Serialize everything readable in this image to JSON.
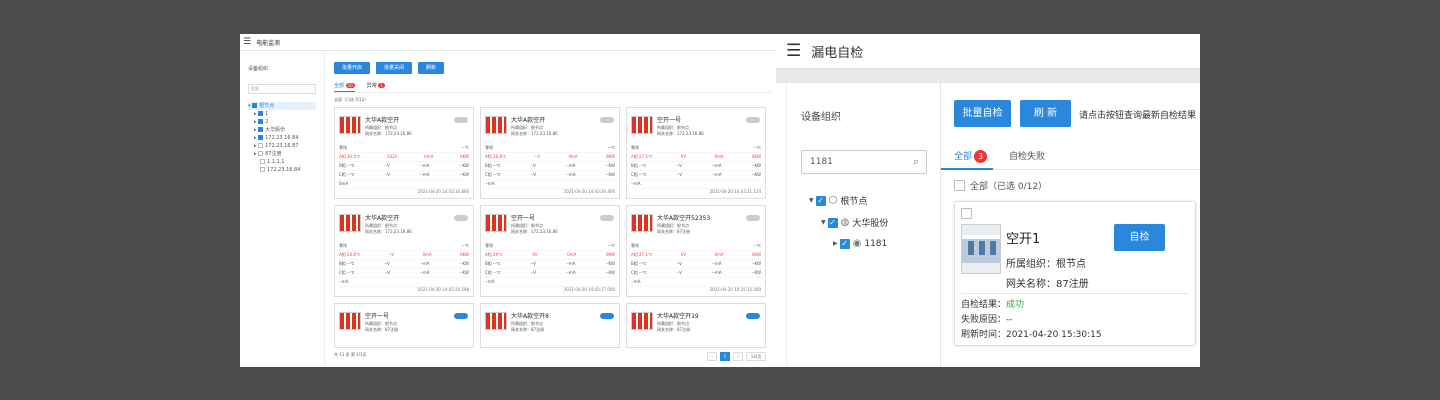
{
  "left": {
    "title": "电能监测",
    "tree_title": "设备组织",
    "search_placeholder": "搜索",
    "tree_nodes": [
      "根节点",
      "1",
      "2",
      "大华股份",
      "172.23.16.84",
      "172.23.16.87",
      "87注册",
      "1.1.1.1",
      "172.23.16.84"
    ],
    "buttons": [
      "批量开启",
      "批量关闭",
      "刷新"
    ],
    "tabs": [
      {
        "label": "全部",
        "badge": "10"
      },
      {
        "label": "异常",
        "badge": "1"
      }
    ],
    "select_all": "全部（已选 0/12）",
    "cards": [
      {
        "name": "大华A款空开",
        "org": "所属组织：根节点",
        "gw": "网关名称：172.23.16.86",
        "on": false,
        "rows": [
          [
            "零线",
            "--℃"
          ],
          [
            "A相 30.0℃",
            "232V",
            "0mA",
            "0KW"
          ],
          [
            "B相 --℃",
            "--V",
            "--mA",
            "--KW"
          ],
          [
            "C相 --℃",
            "--V",
            "--mA",
            "--KW"
          ],
          [
            "0mA",
            ""
          ]
        ],
        "time": "2021-04-20 14:43:16.866"
      },
      {
        "name": "大华A款空开",
        "org": "所属组织：根节点",
        "gw": "网关名称：172.23.16.86",
        "on": false,
        "rows": [
          [
            "零线",
            "--℃"
          ],
          [
            "A相 28.8℃",
            "--V",
            "0mA",
            "0KW"
          ],
          [
            "B相 --℃",
            "--V",
            "--mA",
            "--KW"
          ],
          [
            "C相 --℃",
            "--V",
            "--mA",
            "--KW"
          ],
          [
            "--mA",
            ""
          ]
        ],
        "time": "2021-04-20 14:43:20.406"
      },
      {
        "name": "空开一号",
        "org": "所属组织：根节点",
        "gw": "网关名称：172.23.16.86",
        "on": false,
        "rows": [
          [
            "零线",
            "--℃"
          ],
          [
            "A相 27.5℃",
            "0V",
            "0mA",
            "0KW"
          ],
          [
            "B相 --℃",
            "--V",
            "--mA",
            "--KW"
          ],
          [
            "C相 --℃",
            "--V",
            "--mA",
            "--KW"
          ],
          [
            "--mA",
            ""
          ]
        ],
        "time": "2021-04-20 14:43:21.124"
      },
      {
        "name": "大华A款空开",
        "org": "所属组织：根节点",
        "gw": "网关名称：172.23.16.86",
        "on": false,
        "rows": [
          [
            "零线",
            "--℃"
          ],
          [
            "A相 24.8℃",
            "--V",
            "0mA",
            "0KW"
          ],
          [
            "B相 --℃",
            "--V",
            "--mA",
            "--KW"
          ],
          [
            "C相 --℃",
            "--V",
            "--mA",
            "--KW"
          ],
          [
            "--mA",
            ""
          ]
        ],
        "time": "2021-04-20 14:43:20.598"
      },
      {
        "name": "空开一号",
        "org": "所属组织：根节点",
        "gw": "网关名称：172.23.16.86",
        "on": false,
        "rows": [
          [
            "零线",
            "--℃"
          ],
          [
            "A相 29℃",
            "0V",
            "0mA",
            "0KW"
          ],
          [
            "B相 --℃",
            "--V",
            "--mA",
            "--KW"
          ],
          [
            "C相 --℃",
            "--V",
            "--mA",
            "--KW"
          ],
          [
            "--mA",
            ""
          ]
        ],
        "time": "2021-04-20 14:43:17.000"
      },
      {
        "name": "大华A款空开52353",
        "org": "所属组织：根节点",
        "gw": "网关名称：87注册",
        "on": false,
        "rows": [
          [
            "零线",
            "--℃"
          ],
          [
            "A相 27.1℃",
            "0V",
            "0mA",
            "0KW"
          ],
          [
            "B相 --℃",
            "--V",
            "--mA",
            "--KW"
          ],
          [
            "C相 --℃",
            "--V",
            "--mA",
            "--KW"
          ],
          [
            "--mA",
            ""
          ]
        ],
        "time": "2021-04-20 10:25:15.000"
      },
      {
        "name": "空开一号",
        "org": "所属组织：根节点",
        "gw": "网关名称：87注册",
        "on": true
      },
      {
        "name": "大华A款空开8",
        "org": "所属组织：根节点",
        "gw": "网关名称：87注册",
        "on": true
      },
      {
        "name": "大华A款空开19",
        "org": "所属组织：根节点",
        "gw": "网关名称：87注册",
        "on": true
      }
    ],
    "footer_total": "共 11 条 第 1/1页",
    "page": "1",
    "page_size": "12/页"
  },
  "right": {
    "title": "漏电自检",
    "tree_title": "设备组织",
    "search_value": "1181",
    "tree_nodes": [
      "根节点",
      "大华股份",
      "1181"
    ],
    "btn_batch": "批量自检",
    "btn_refresh": "刷 新",
    "hint": "请点击按钮查询最新自检结果",
    "tab_all": "全部",
    "tab_all_badge": "3",
    "tab_fail": "自检失败",
    "select_all": "全部（已选 0/12）",
    "card": {
      "name": "空开1",
      "org": "所属组织：根节点",
      "gw": "网关名称：87注册",
      "btn": "自检",
      "result_label": "自检结果：",
      "result_value": "成功",
      "fail_reason": "失败原因：--",
      "refresh_time": "刷新时间：2021-04-20 15:30:15"
    }
  }
}
